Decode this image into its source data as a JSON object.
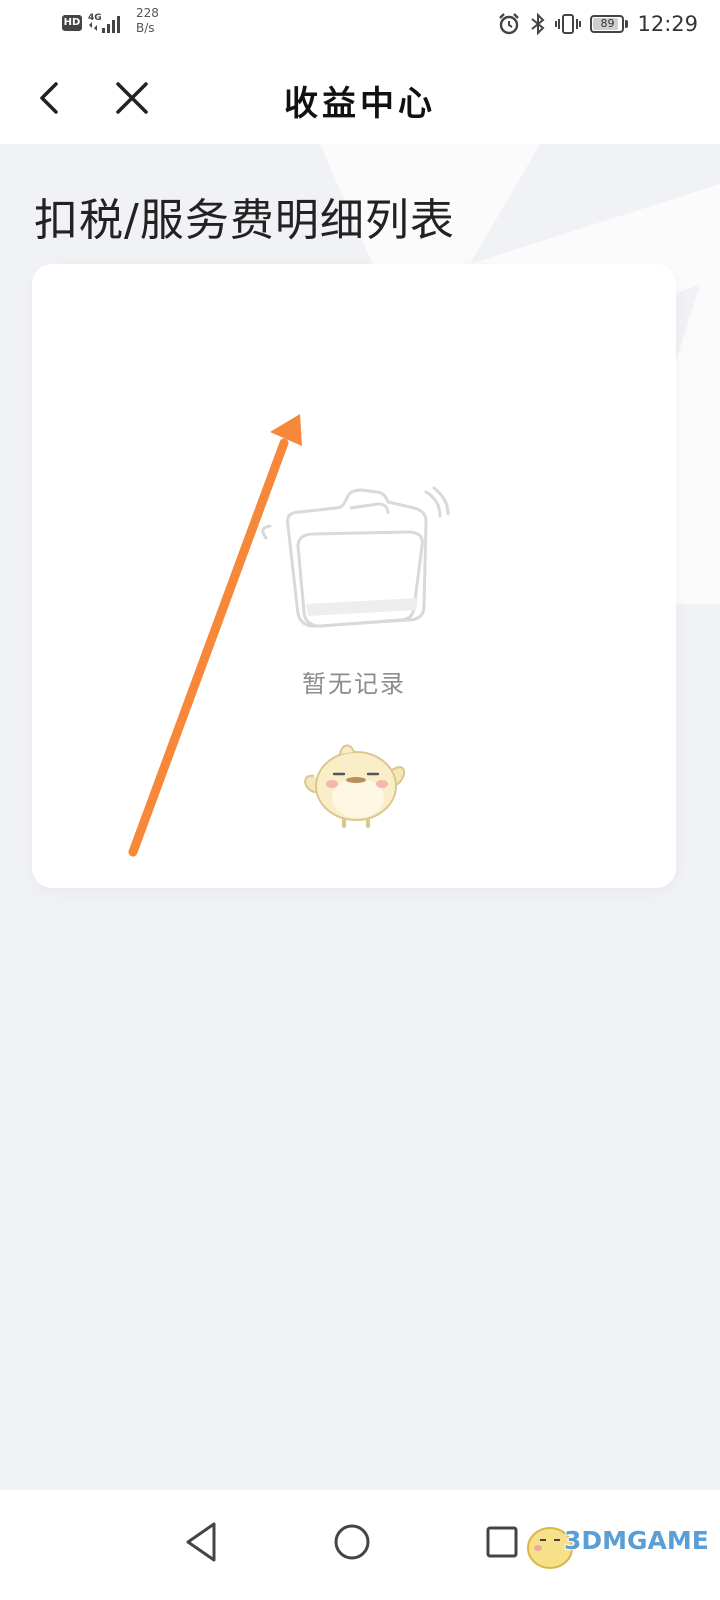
{
  "status_bar": {
    "hd_label": "HD",
    "network_label": "4G",
    "speed_value": "228",
    "speed_unit": "B/s",
    "battery": "89",
    "battery_level": 0.89,
    "time": "12:29",
    "icons": [
      "alarm-icon",
      "bluetooth-icon",
      "vibrate-icon",
      "battery-icon"
    ]
  },
  "header": {
    "title": "收益中心",
    "back_icon": "chevron-left-icon",
    "close_icon": "close-icon"
  },
  "page": {
    "section_title": "扣税/服务费明细列表"
  },
  "empty_state": {
    "text": "暂无记录",
    "illustration": "folder-icon",
    "mascot": "mascot-icon"
  },
  "annotation": {
    "arrow_color": "#f7883a"
  },
  "nav_bar": {
    "items": [
      "back-triangle-icon",
      "home-circle-icon",
      "recents-square-icon"
    ]
  },
  "watermark": {
    "text": "3DMGAME"
  }
}
